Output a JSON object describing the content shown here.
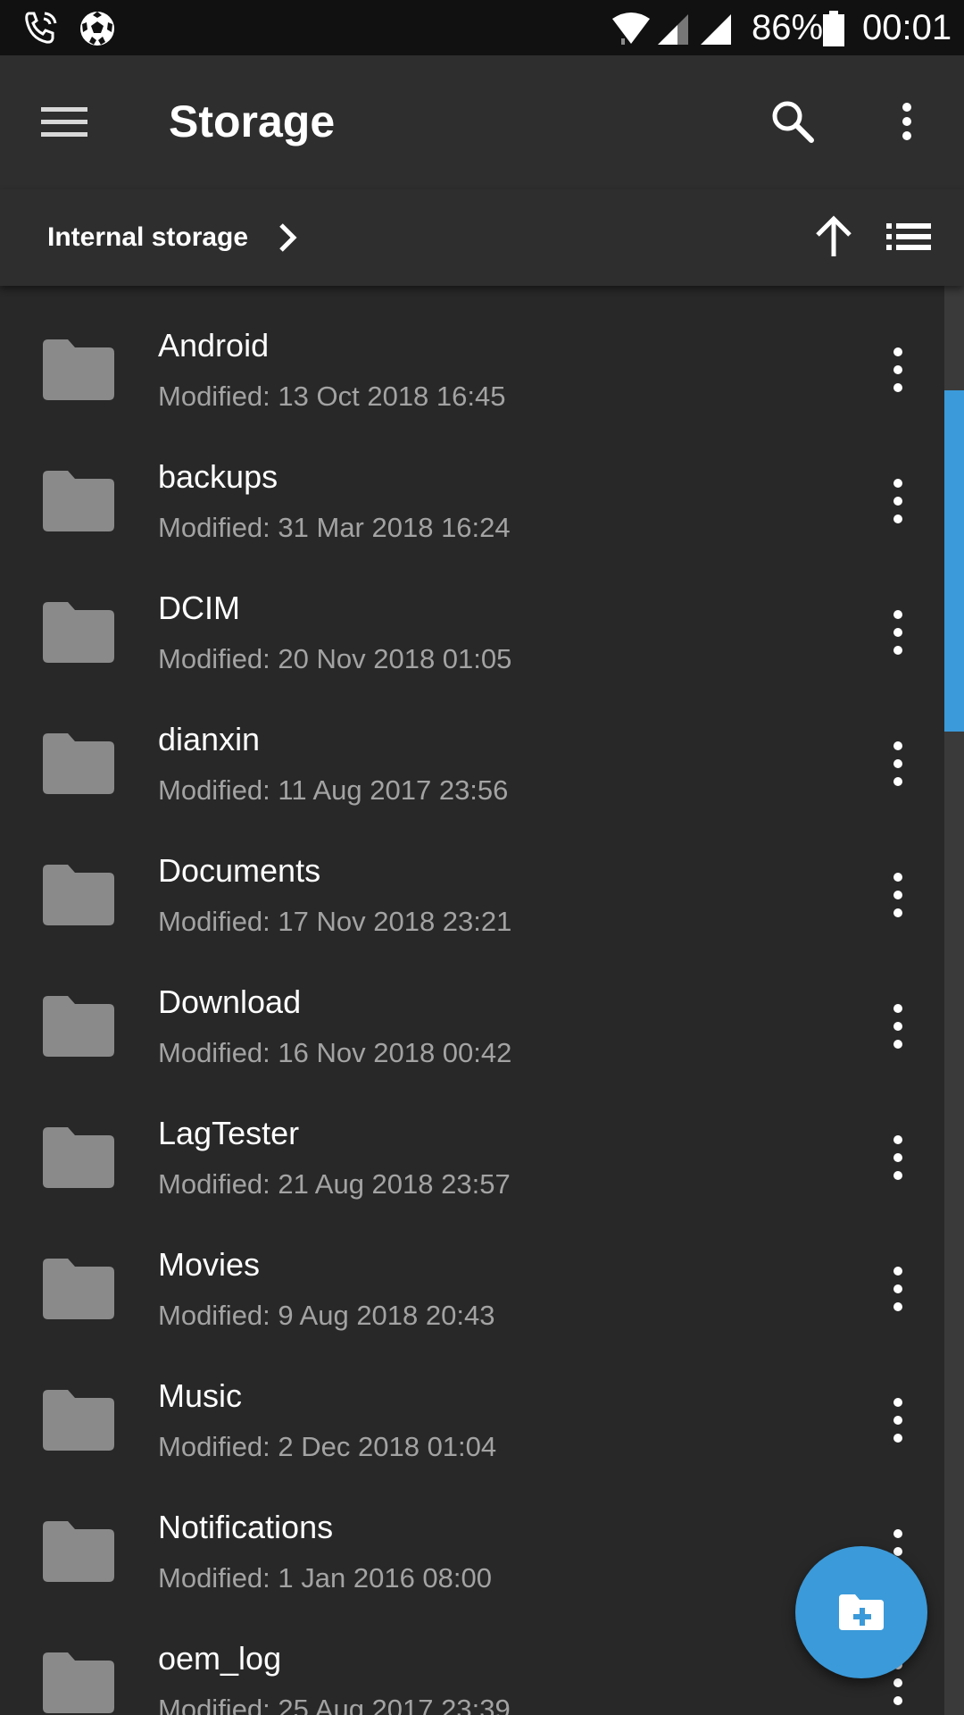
{
  "status_bar": {
    "left_icons": [
      "phone-wifi-call-icon",
      "soccer-ball-icon"
    ],
    "right_icons": [
      "wifi-icon",
      "signal-icon",
      "signal-icon",
      "battery-icon"
    ],
    "battery": "86%",
    "time": "00:01"
  },
  "toolbar": {
    "menu_icon": "menu-icon",
    "title": "Storage",
    "search_icon": "search-icon",
    "overflow_icon": "more-vert-icon"
  },
  "breadcrumb": {
    "label": "Internal storage",
    "chevron_icon": "chevron-right-icon",
    "up_icon": "arrow-up-icon",
    "view_icon": "list-view-icon"
  },
  "files": [
    {
      "name": "Android",
      "modified": "Modified: 13 Oct 2018 16:45"
    },
    {
      "name": "backups",
      "modified": "Modified: 31 Mar 2018 16:24"
    },
    {
      "name": "DCIM",
      "modified": "Modified: 20 Nov 2018 01:05"
    },
    {
      "name": "dianxin",
      "modified": "Modified: 11 Aug 2017 23:56"
    },
    {
      "name": "Documents",
      "modified": "Modified: 17 Nov 2018 23:21"
    },
    {
      "name": "Download",
      "modified": "Modified: 16 Nov 2018 00:42"
    },
    {
      "name": "LagTester",
      "modified": "Modified: 21 Aug 2018 23:57"
    },
    {
      "name": "Movies",
      "modified": "Modified: 9 Aug 2018 20:43"
    },
    {
      "name": "Music",
      "modified": "Modified: 2 Dec 2018 01:04"
    },
    {
      "name": "Notifications",
      "modified": "Modified: 1 Jan 2016 08:00"
    },
    {
      "name": "oem_log",
      "modified": "Modified: 25 Aug 2017 23:39"
    }
  ],
  "scroll": {
    "thumb_start_fraction": 0.073,
    "thumb_end_fraction": 0.312
  },
  "fab": {
    "icon": "new-folder-icon"
  },
  "colors": {
    "accent": "#3b9ad9",
    "background": "#282828",
    "toolbar": "#2e2e2e",
    "status_bar": "#111111",
    "folder_icon": "#8a8a8a",
    "secondary_text": "#a3a3a3"
  }
}
